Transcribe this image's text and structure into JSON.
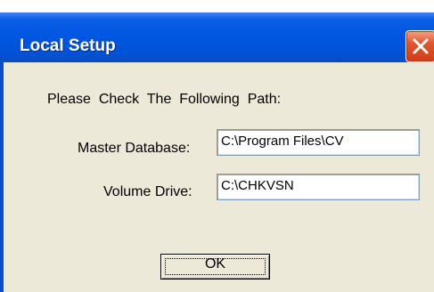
{
  "window": {
    "title": "Local Setup"
  },
  "instructions": "Please  Check  The  Following  Path:",
  "fields": {
    "master_database": {
      "label": "Master Database:",
      "value": "C:\\Program Files\\CV"
    },
    "volume_drive": {
      "label": "Volume Drive:",
      "value": "C:\\CHKVSN"
    }
  },
  "buttons": {
    "ok": "OK",
    "close_icon": "close-icon"
  },
  "colors": {
    "titlebar": "#0054E3",
    "dialog_background": "#ECE9D8",
    "close_button": "#D9532A"
  }
}
